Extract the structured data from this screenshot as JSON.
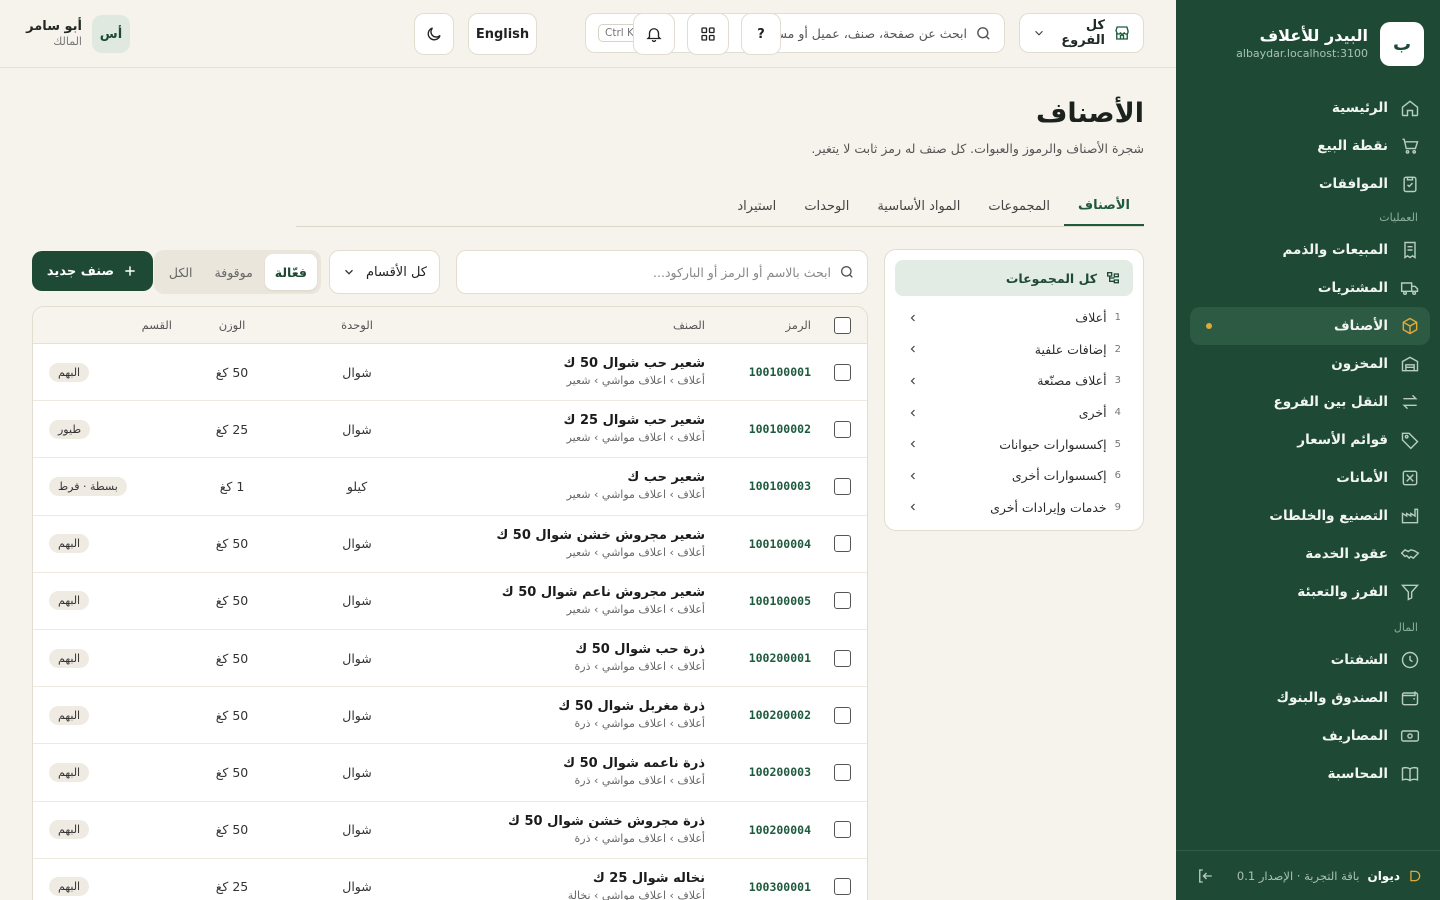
{
  "sidebar": {
    "logo_letter": "ب",
    "brand_name": "البيدر للأعلاف",
    "host": "albaydar.localhost:3100",
    "items_top": [
      {
        "label": "الرئيسية",
        "icon": "home-icon"
      },
      {
        "label": "نقطة البيع",
        "icon": "cart-icon"
      },
      {
        "label": "الموافقات",
        "icon": "clipboard-check-icon"
      }
    ],
    "section_ops": "العمليات",
    "items_ops": [
      {
        "label": "المبيعات والذمم",
        "icon": "receipt-icon"
      },
      {
        "label": "المشتريات",
        "icon": "truck-icon"
      },
      {
        "label": "الأصناف",
        "icon": "box-icon",
        "active": true
      },
      {
        "label": "المخزون",
        "icon": "warehouse-icon"
      },
      {
        "label": "النقل بين الفروع",
        "icon": "transfer-icon"
      },
      {
        "label": "قوائم الأسعار",
        "icon": "tag-icon"
      },
      {
        "label": "الأمانات",
        "icon": "deposit-icon"
      },
      {
        "label": "التصنيع والخلطات",
        "icon": "factory-icon"
      },
      {
        "label": "عقود الخدمة",
        "icon": "handshake-icon"
      },
      {
        "label": "الفرز والتعبئة",
        "icon": "filter-icon"
      }
    ],
    "section_money": "المال",
    "items_money": [
      {
        "label": "الشفتات",
        "icon": "clock-icon"
      },
      {
        "label": "الصندوق والبنوك",
        "icon": "wallet-icon"
      },
      {
        "label": "المصاريف",
        "icon": "banknote-icon"
      },
      {
        "label": "المحاسبة",
        "icon": "book-icon"
      }
    ],
    "footer": {
      "app": "ديوان",
      "plan": "باقة التجربة · الإصدار 0.1"
    }
  },
  "topbar": {
    "branch": "كل الفروع",
    "search_placeholder": "ابحث عن صفحة، صنف، عميل أو مستند...",
    "shortcut": "Ctrl K",
    "help": "?",
    "language": "English",
    "user_initials": "أس",
    "user_name": "أبو سامر",
    "user_role": "المالك"
  },
  "page": {
    "title": "الأصناف",
    "subtitle": "شجرة الأصناف والرموز والعبوات. كل صنف له رمز ثابت لا يتغير.",
    "tabs": [
      "الأصناف",
      "المجموعات",
      "المواد الأساسية",
      "الوحدات",
      "استيراد"
    ]
  },
  "tree": {
    "all_label": "كل المجموعات",
    "groups": [
      {
        "num": "1",
        "label": "أعلاف"
      },
      {
        "num": "2",
        "label": "إضافات علفية"
      },
      {
        "num": "3",
        "label": "أعلاف مصنّعة"
      },
      {
        "num": "4",
        "label": "أخرى"
      },
      {
        "num": "5",
        "label": "إكسسوارات حيوانات"
      },
      {
        "num": "6",
        "label": "إكسسوارات أخرى"
      },
      {
        "num": "9",
        "label": "خدمات وإيرادات أخرى"
      }
    ]
  },
  "filters": {
    "search_placeholder": "ابحث بالاسم أو الرمز أو الباركود...",
    "department": "كل الأقسام",
    "status_active": "فعّالة",
    "status_stopped": "موقوفة",
    "status_all": "الكل",
    "new_button": "صنف جديد"
  },
  "table": {
    "headers": {
      "code": "الرمز",
      "item": "الصنف",
      "unit": "الوحدة",
      "weight": "الوزن",
      "section": "القسم"
    },
    "rows": [
      {
        "code": "100100001",
        "name": "شعير حب شوال 50 ك",
        "path": "أعلاف › اعلاف مواشي › شعير",
        "unit": "شوال",
        "weight": "50 كغ",
        "section": "البهم"
      },
      {
        "code": "100100002",
        "name": "شعير حب شوال 25 ك",
        "path": "أعلاف › اعلاف مواشي › شعير",
        "unit": "شوال",
        "weight": "25 كغ",
        "section": "طيور"
      },
      {
        "code": "100100003",
        "name": "شعير حب ك",
        "path": "أعلاف › اعلاف مواشي › شعير",
        "unit": "كيلو",
        "weight": "1 كغ",
        "section": "بسطة · فرط"
      },
      {
        "code": "100100004",
        "name": "شعير مجروش خشن شوال 50 ك",
        "path": "أعلاف › اعلاف مواشي › شعير",
        "unit": "شوال",
        "weight": "50 كغ",
        "section": "البهم"
      },
      {
        "code": "100100005",
        "name": "شعير مجروش ناعم شوال 50 ك",
        "path": "أعلاف › اعلاف مواشي › شعير",
        "unit": "شوال",
        "weight": "50 كغ",
        "section": "البهم"
      },
      {
        "code": "100200001",
        "name": "ذرة حب شوال 50 ك",
        "path": "أعلاف › اعلاف مواشي › ذرة",
        "unit": "شوال",
        "weight": "50 كغ",
        "section": "البهم"
      },
      {
        "code": "100200002",
        "name": "ذرة مغربل شوال 50 ك",
        "path": "أعلاف › اعلاف مواشي › ذرة",
        "unit": "شوال",
        "weight": "50 كغ",
        "section": "البهم"
      },
      {
        "code": "100200003",
        "name": "ذرة ناعمه شوال 50 ك",
        "path": "أعلاف › اعلاف مواشي › ذرة",
        "unit": "شوال",
        "weight": "50 كغ",
        "section": "البهم"
      },
      {
        "code": "100200004",
        "name": "ذرة مجروش خشن شوال 50 ك",
        "path": "أعلاف › اعلاف مواشي › ذرة",
        "unit": "شوال",
        "weight": "50 كغ",
        "section": "البهم"
      },
      {
        "code": "100300001",
        "name": "نخاله شوال 25 ك",
        "path": "أعلاف › اعلاف مواشي › نخالة",
        "unit": "شوال",
        "weight": "25 كغ",
        "section": "البهم"
      }
    ]
  },
  "colors": {
    "primary": "#1e4a35",
    "accent": "#e0a93b",
    "background": "#f6f3ec"
  }
}
